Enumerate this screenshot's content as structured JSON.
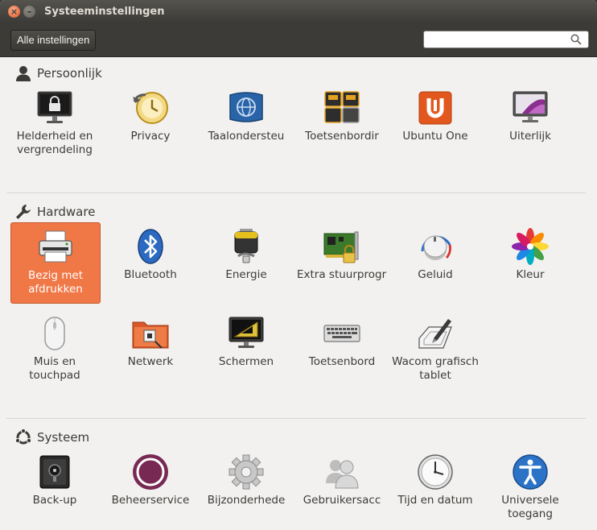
{
  "window": {
    "title": "Systeeminstellingen"
  },
  "toolbar": {
    "all_settings_label": "Alle instellingen",
    "search": {
      "value": "",
      "placeholder": ""
    }
  },
  "sections": {
    "personal": {
      "label": "Persoonlijk",
      "items": [
        {
          "label": "Helderheid en vergrendeling",
          "icon": "lock-screen-icon"
        },
        {
          "label": "Privacy",
          "icon": "privacy-icon"
        },
        {
          "label": "Taalondersteu",
          "icon": "language-support-icon"
        },
        {
          "label": "Toetsenbordir",
          "icon": "keyboard-layout-icon"
        },
        {
          "label": "Ubuntu One",
          "icon": "ubuntu-one-icon"
        },
        {
          "label": "Uiterlijk",
          "icon": "appearance-icon"
        }
      ]
    },
    "hardware": {
      "label": "Hardware",
      "items": [
        {
          "label": "Bezig met afdrukken",
          "icon": "printer-icon",
          "selected": true
        },
        {
          "label": "Bluetooth",
          "icon": "bluetooth-icon"
        },
        {
          "label": "Energie",
          "icon": "battery-icon"
        },
        {
          "label": "Extra stuurprogrami",
          "icon": "driver-card-icon"
        },
        {
          "label": "Geluid",
          "icon": "sound-icon"
        },
        {
          "label": "Kleur",
          "icon": "color-icon"
        },
        {
          "label": "Muis en touchpad",
          "icon": "mouse-icon"
        },
        {
          "label": "Netwerk",
          "icon": "network-folder-icon"
        },
        {
          "label": "Schermen",
          "icon": "display-icon"
        },
        {
          "label": "Toetsenbord",
          "icon": "keyboard-icon"
        },
        {
          "label": "Wacom grafisch tablet",
          "icon": "wacom-tablet-icon"
        }
      ]
    },
    "system": {
      "label": "Systeem",
      "items": [
        {
          "label": "Back-up",
          "icon": "backup-safe-icon"
        },
        {
          "label": "Beheerservice",
          "icon": "landscape-service-icon"
        },
        {
          "label": "Bijzonderhede",
          "icon": "details-gear-icon"
        },
        {
          "label": "Gebruikersacc",
          "icon": "user-accounts-icon"
        },
        {
          "label": "Tijd en datum",
          "icon": "clock-icon"
        },
        {
          "label": "Universele toegang",
          "icon": "accessibility-icon"
        }
      ]
    }
  },
  "colors": {
    "selection": "#f07746",
    "titlebar": "#3c3b37",
    "background": "#f2f1f0",
    "ubuntu_orange": "#e2571e"
  }
}
